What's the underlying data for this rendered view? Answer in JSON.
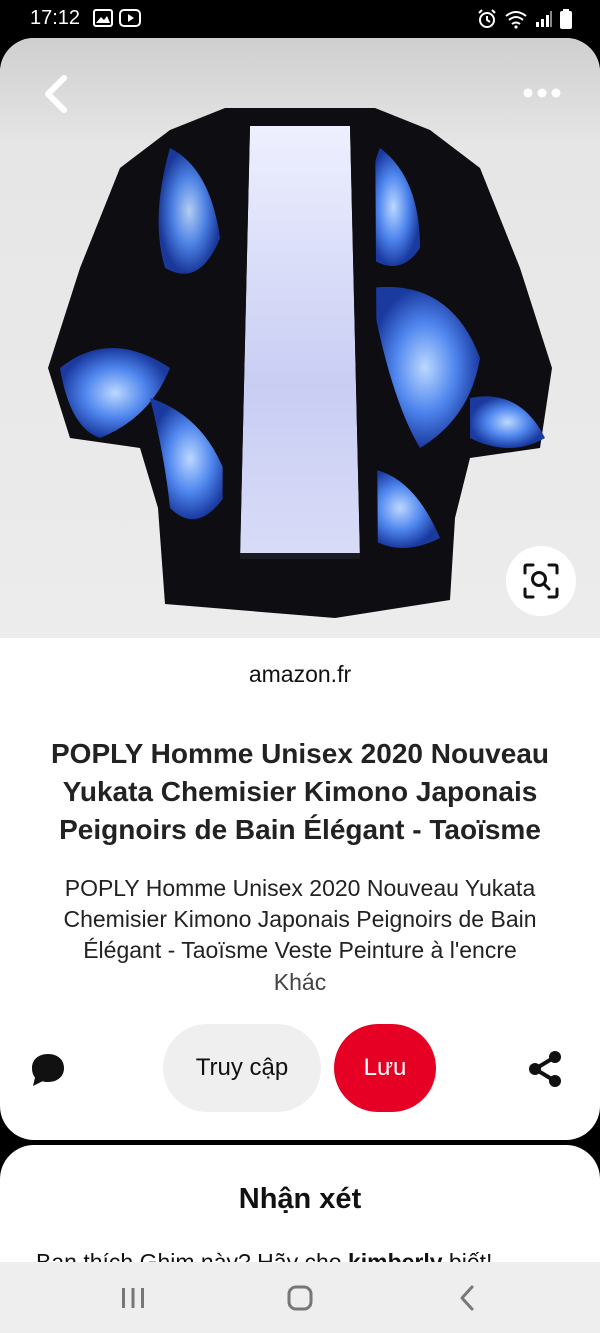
{
  "status_bar": {
    "time": "17:12",
    "left_icons": [
      "gallery-icon",
      "youtube-icon"
    ],
    "right_icons": [
      "alarm-icon",
      "wifi-icon",
      "signal-icon",
      "battery-icon"
    ]
  },
  "pin": {
    "image_alt": "Kimono with blue dragon print",
    "source_domain": "amazon.fr",
    "title": "POPLY Homme Unisex 2020 Nouveau Yukata Chemisier Kimono Japonais Peignoirs de Bain Élégant - Taoïsme",
    "description": "POPLY Homme Unisex 2020 Nouveau Yukata Chemisier Kimono Japonais Peignoirs de Bain Élégant - Taoïsme Veste Peinture à l'encre",
    "more_label": "Khác"
  },
  "actions": {
    "visit_label": "Truy cập",
    "save_label": "Lưu"
  },
  "comments": {
    "title": "Nhận xét",
    "prompt_before": "Bạn thích Ghim này? Hãy cho ",
    "prompt_user": "kimberly",
    "prompt_after": " biết!"
  },
  "colors": {
    "save_red": "#e60023",
    "visit_gray": "#efefef",
    "kimono_black": "#0d0d12",
    "dragon_blue": "#3a6fe0"
  }
}
